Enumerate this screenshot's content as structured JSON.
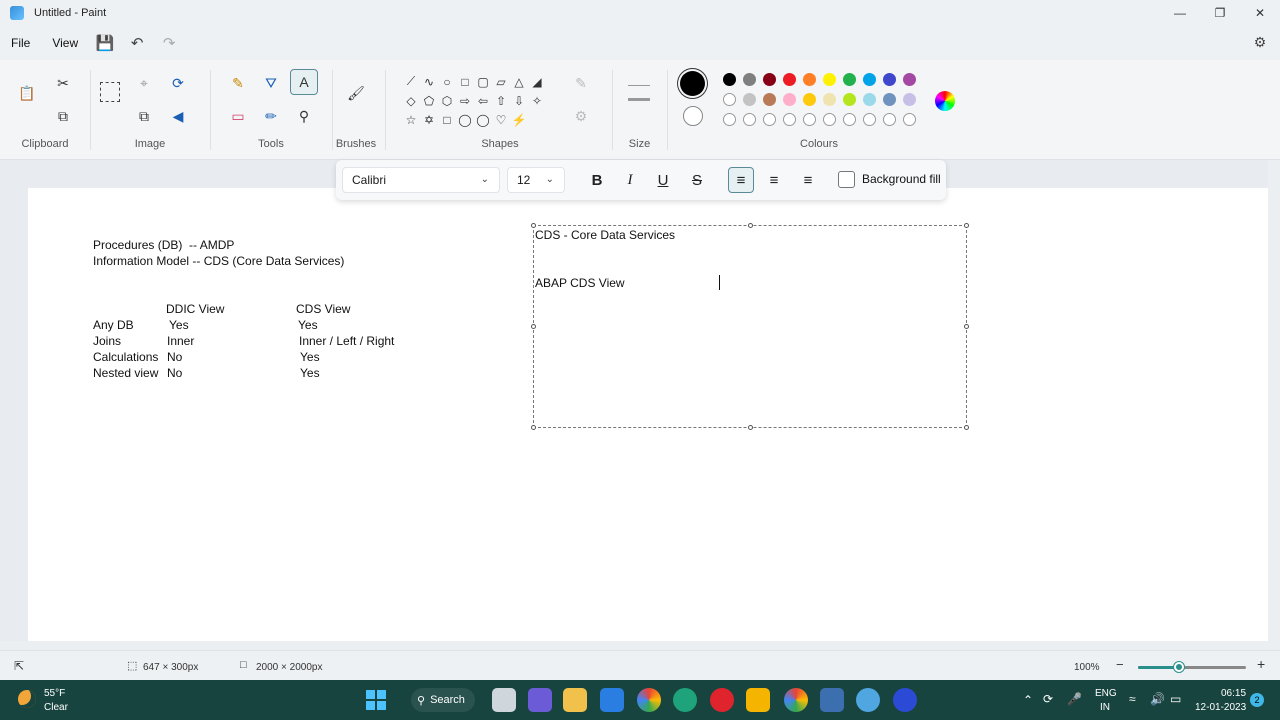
{
  "window": {
    "title": "Untitled - Paint"
  },
  "menu": {
    "file": "File",
    "view": "View"
  },
  "ribbon": {
    "groups": {
      "clipboard": "Clipboard",
      "image": "Image",
      "tools": "Tools",
      "brushes": "Brushes",
      "shapes": "Shapes",
      "size": "Size",
      "colours": "Colours"
    },
    "palette_row1": [
      "#000000",
      "#7f7f7f",
      "#880015",
      "#ed1c24",
      "#ff7f27",
      "#fff200",
      "#22b14c",
      "#00a2e8",
      "#3f48cc",
      "#a349a4"
    ],
    "palette_row2": [
      "#ffffff",
      "#c3c3c3",
      "#b97a57",
      "#ffaec9",
      "#ffc90e",
      "#efe4b0",
      "#b5e61d",
      "#99d9ea",
      "#7092be",
      "#c8bfe7"
    ]
  },
  "text_toolbar": {
    "font": "Calibri",
    "size": "12",
    "background_fill": "Background fill"
  },
  "canvas": {
    "left_block": {
      "line1": "Procedures (DB)  -- AMDP",
      "line2": "Information Model -- CDS (Core Data Services)",
      "col_header_ddic": "DDIC View",
      "col_header_cds": "CDS View",
      "rows": [
        {
          "label": "Any DB",
          "ddic": "Yes",
          "cds": "Yes"
        },
        {
          "label": "Joins",
          "ddic": "Inner",
          "cds": "Inner / Left / Right"
        },
        {
          "label": "Calculations",
          "ddic": "No",
          "cds": "Yes"
        },
        {
          "label": "Nested view",
          "ddic": "No",
          "cds": "Yes"
        }
      ]
    },
    "textbox": {
      "line1": "CDS - Core Data Services",
      "line2": "ABAP CDS View"
    }
  },
  "status": {
    "selection_size": "647 × 300px",
    "canvas_size": "2000 × 2000px",
    "zoom": "100%",
    "zoom_fraction": 0.38
  },
  "taskbar": {
    "temp": "55°F",
    "condition": "Clear",
    "search": "Search",
    "lang1": "ENG",
    "lang2": "IN",
    "time": "06:15",
    "date": "12-01-2023",
    "notifications": "2"
  }
}
